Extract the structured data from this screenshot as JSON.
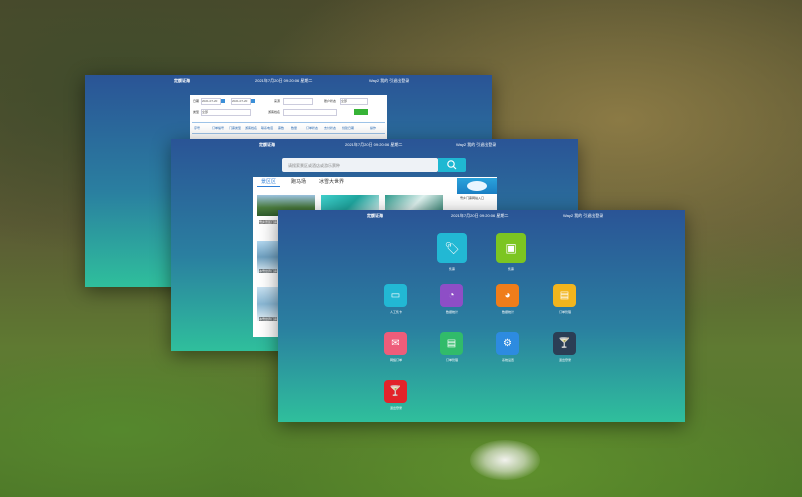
{
  "window1": {
    "app_title": "定额证海",
    "datetime": "2021年7月20日 09:20:06 星期二",
    "user_links": "Way2   我的   引退出登录",
    "form": {
      "date_label": "日期",
      "date_from": "2021-07-20",
      "date_to": "2021-07-20",
      "source_label": "来源",
      "status_label": "账户状态",
      "status_value": "全部",
      "type_label": "类型",
      "type_value": "全部",
      "tourist_label": "游客姓名",
      "confirm_label": "确认",
      "columns": [
        "序号",
        "订单编号",
        "门票类型",
        "游客姓名",
        "联系电话",
        "票数",
        "数量",
        "订单状态",
        "支付状态",
        "创建日期",
        "操作"
      ]
    }
  },
  "window2": {
    "app_title": "定额证海",
    "datetime": "2021年7月20日 09:20:06 星期二",
    "user_links": "Way2   我的   引退出登录",
    "search": {
      "placeholder": "请搜索景区或酒店或游乐票种"
    },
    "tabs": [
      {
        "label": "景区区"
      },
      {
        "label": "跑马场"
      },
      {
        "label": "冰雪大世界"
      }
    ],
    "items": [
      {
        "title": "雪乡景区门票"
      },
      {
        "title": "冰雪世界门票"
      },
      {
        "title": "冰雪世界门票"
      }
    ],
    "side_label": "雪乡门票网站入口"
  },
  "window3": {
    "app_title": "定额证海",
    "datetime": "2021年7月20日 09:20:06 星期二",
    "user_links": "Way2   我的   引退出登录",
    "icons": [
      {
        "label": "售票",
        "icon": "tag-icon",
        "color": "#22b8d4"
      },
      {
        "label": "售票",
        "icon": "printer-icon",
        "color": "#7cc521"
      },
      {
        "label": "人工售卡",
        "icon": "card-icon",
        "color": "#22b8d4"
      },
      {
        "label": "数据统计",
        "icon": "pie-chart-icon",
        "color": "#8e4ec6"
      },
      {
        "label": "数据统计",
        "icon": "pie-chart-icon",
        "color": "#ef7d1a"
      },
      {
        "label": "订单管理",
        "icon": "document-icon",
        "color": "#f2b51d"
      },
      {
        "label": "网络订单",
        "icon": "inbox-icon",
        "color": "#ee5d7a"
      },
      {
        "label": "订单管理",
        "icon": "document-icon",
        "color": "#31bb6a"
      },
      {
        "label": "系统设置",
        "icon": "gear-icon",
        "color": "#2d8be0"
      },
      {
        "label": "退出登录",
        "icon": "cocktail-icon",
        "color": "#2b3e55"
      },
      {
        "label": "退出登录",
        "icon": "cocktail-icon",
        "color": "#e3232a"
      }
    ]
  }
}
